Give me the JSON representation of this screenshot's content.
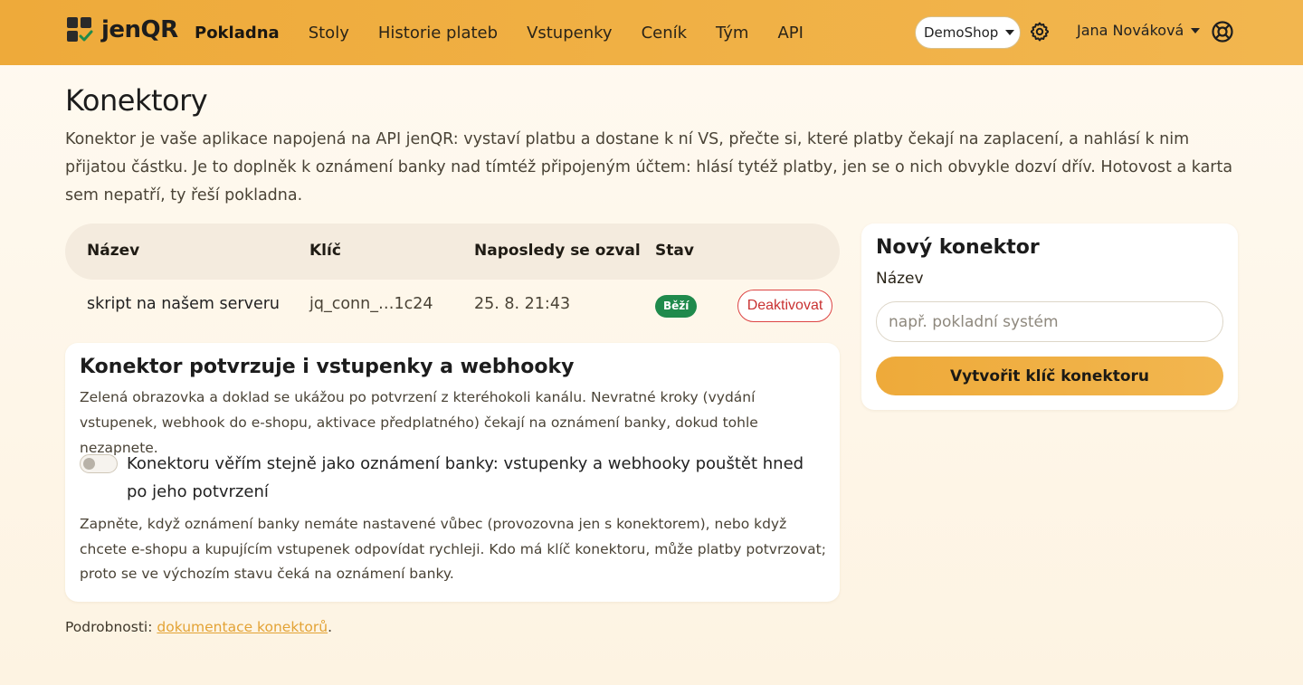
{
  "navbar": {
    "brand": "jenQR",
    "links": [
      "Pokladna",
      "Stoly",
      "Historie plateb",
      "Vstupenky",
      "Ceník",
      "Tým",
      "API"
    ],
    "active_index": 0,
    "shop": "DemoShop",
    "user": "Jana Nováková"
  },
  "page": {
    "title": "Konektory",
    "intro": "Konektor je vaše aplikace napojená na API jenQR: vystaví platbu a dostane k ní VS, přečte si, které platby čekají na zaplacení, a nahlásí k nim přijatou částku. Je to doplněk k oznámení banky nad tímtéž připojeným účtem: hlásí tytéž platby, jen se o nich obvykle dozví dřív. Hotovost a karta sem nepatří, ty řeší pokladna."
  },
  "table": {
    "headers": {
      "name": "Název",
      "key": "Klíč",
      "last_seen": "Naposledy se ozval",
      "status": "Stav"
    },
    "rows": [
      {
        "name": "skript na našem serveru",
        "key": "jq_conn_…1c24",
        "last_seen": "25. 8. 21:43",
        "status": "Běží",
        "action": "Deaktivovat"
      }
    ]
  },
  "trust_card": {
    "title": "Konektor potvrzuje i vstupenky a webhooky",
    "note": "Zelená obrazovka a doklad se ukážou po potvrzení z kteréhokoli kanálu. Nevratné kroky (vydání vstupenek, webhook do e-shopu, aktivace předplatného) čekají na oznámení banky, dokud tohle nezapnete.",
    "toggle_label": "Konektoru věřím stejně jako oznámení banky: vstupenky a webhooky pouštět hned po jeho potvrzení",
    "toggle_on": false,
    "help": "Zapněte, když oznámení banky nemáte nastavené vůbec (provozovna jen s konektorem), nebo když chcete e-shopu a kupujícím vstupenek odpovídat rychleji. Kdo má klíč konektoru, může platby potvrzovat; proto se ve výchozím stavu čeká na oznámení banky."
  },
  "new_connector": {
    "title": "Nový konektor",
    "label": "Název",
    "placeholder": "např. pokladní systém",
    "value": "",
    "button": "Vytvořit klíč konektoru"
  },
  "footer": {
    "prefix": "Podrobnosti: ",
    "link": "dokumentace konektorů",
    "suffix": "."
  },
  "colors": {
    "accent": "#f0b042",
    "success": "#1f8a4c",
    "danger": "#c93232",
    "link": "#e3a335"
  }
}
